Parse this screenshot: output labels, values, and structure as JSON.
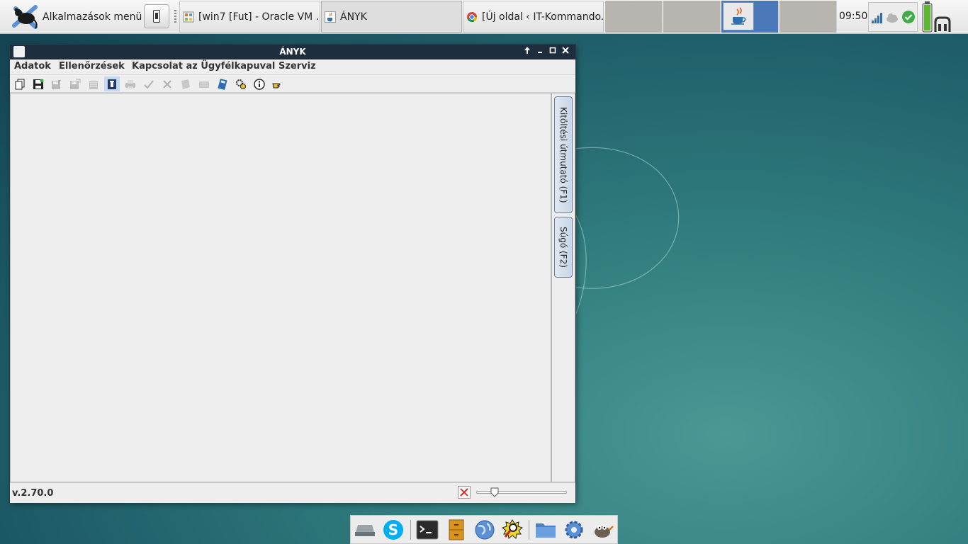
{
  "top_panel": {
    "app_menu_label": "Alkalmazások menü",
    "tasks": [
      {
        "label": "[win7 [Fut] - Oracle VM ..."
      },
      {
        "label": "ÁNYK"
      },
      {
        "label": "[Új oldal ‹ IT-Kommando..."
      }
    ],
    "clock": "09:50"
  },
  "window": {
    "title": "ÁNYK",
    "menu": [
      "Adatok",
      "Ellenőrzések",
      "Kapcsolat az Ügyfélkapuval",
      "Szerviz"
    ],
    "side_tabs": [
      "Kitöltési útmutató (F1)",
      "Súgó (F2)"
    ],
    "version": "v.2.70.0",
    "zoom_level": 0.17
  },
  "colors": {
    "title_bar": "#1e2e3e",
    "workspace_active": "#4a78b8",
    "desktop": "#2f7b7d"
  }
}
